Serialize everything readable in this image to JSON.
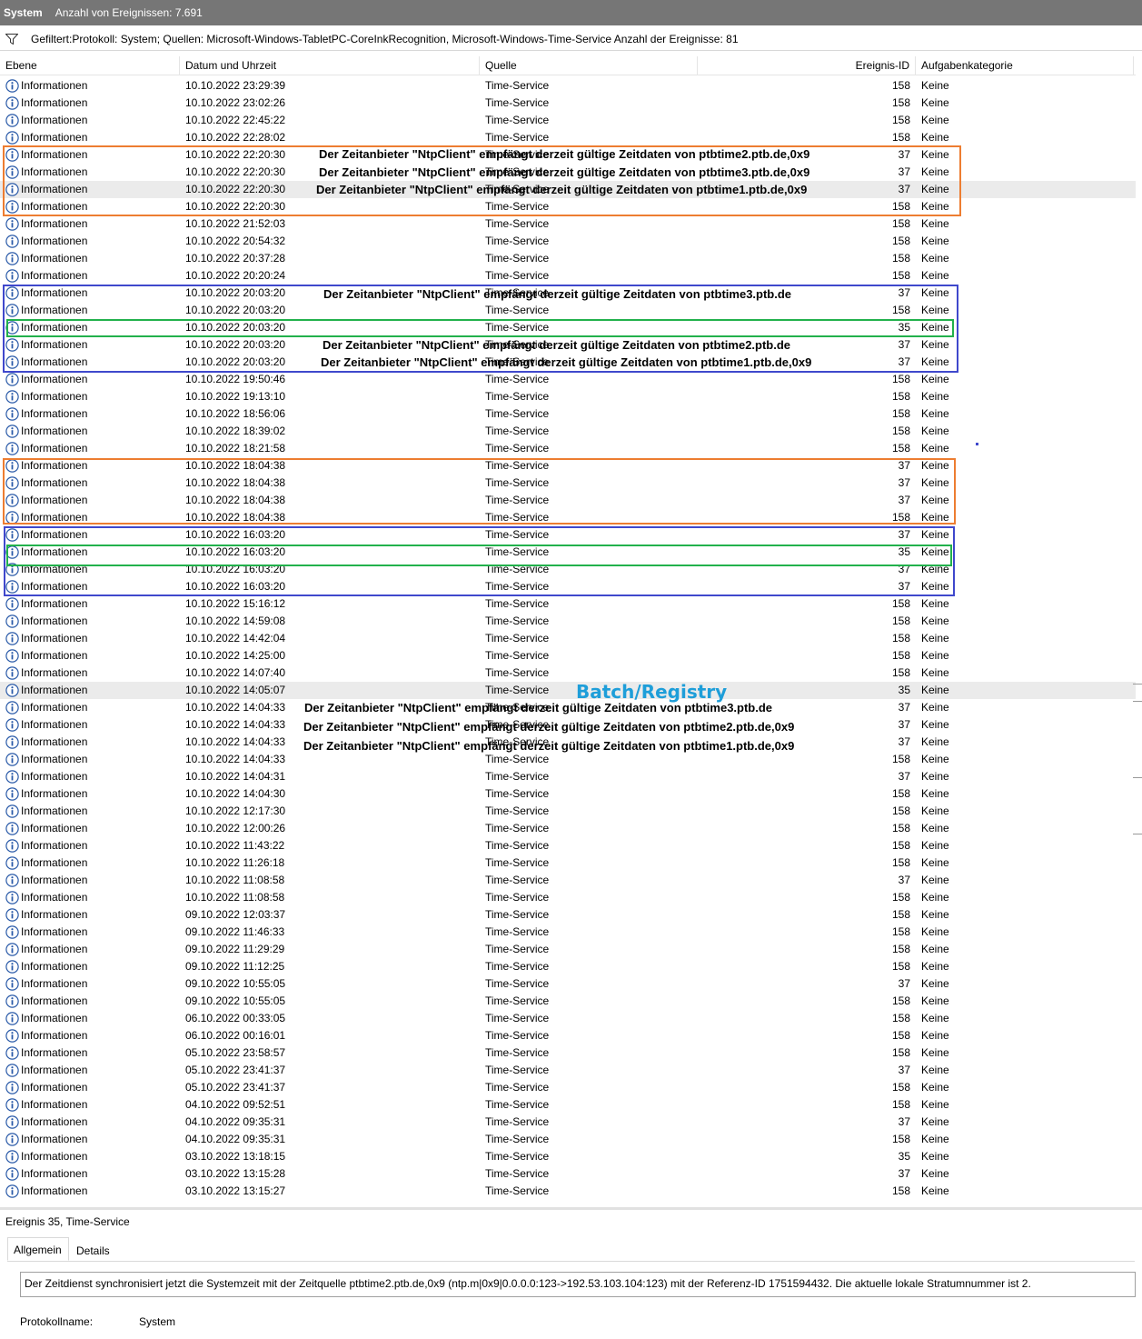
{
  "titlebar": {
    "log_name": "System",
    "event_count": "Anzahl von Ereignissen: 7.691"
  },
  "filter": {
    "text": "Gefiltert:Protokoll: System; Quellen: Microsoft-Windows-TabletPC-CoreInkRecognition, Microsoft-Windows-Time-Service Anzahl der Ereignisse: 81"
  },
  "columns": {
    "level": "Ebene",
    "datetime": "Datum und Uhrzeit",
    "source": "Quelle",
    "event_id": "Ereignis-ID",
    "category": "Aufgabenkategorie"
  },
  "level_text": "Informationen",
  "source_text": "Time-Service",
  "category_text": "Keine",
  "rows": [
    [
      "10.10.2022 23:29:39",
      "158"
    ],
    [
      "10.10.2022 23:02:26",
      "158"
    ],
    [
      "10.10.2022 22:45:22",
      "158"
    ],
    [
      "10.10.2022 22:28:02",
      "158"
    ],
    [
      "10.10.2022 22:20:30",
      "37"
    ],
    [
      "10.10.2022 22:20:30",
      "37"
    ],
    [
      "10.10.2022 22:20:30",
      "37"
    ],
    [
      "10.10.2022 22:20:30",
      "158"
    ],
    [
      "10.10.2022 21:52:03",
      "158"
    ],
    [
      "10.10.2022 20:54:32",
      "158"
    ],
    [
      "10.10.2022 20:37:28",
      "158"
    ],
    [
      "10.10.2022 20:20:24",
      "158"
    ],
    [
      "10.10.2022 20:03:20",
      "37"
    ],
    [
      "10.10.2022 20:03:20",
      "158"
    ],
    [
      "10.10.2022 20:03:20",
      "35"
    ],
    [
      "10.10.2022 20:03:20",
      "37"
    ],
    [
      "10.10.2022 20:03:20",
      "37"
    ],
    [
      "10.10.2022 19:50:46",
      "158"
    ],
    [
      "10.10.2022 19:13:10",
      "158"
    ],
    [
      "10.10.2022 18:56:06",
      "158"
    ],
    [
      "10.10.2022 18:39:02",
      "158"
    ],
    [
      "10.10.2022 18:21:58",
      "158"
    ],
    [
      "10.10.2022 18:04:38",
      "37"
    ],
    [
      "10.10.2022 18:04:38",
      "37"
    ],
    [
      "10.10.2022 18:04:38",
      "37"
    ],
    [
      "10.10.2022 18:04:38",
      "158"
    ],
    [
      "10.10.2022 16:03:20",
      "37"
    ],
    [
      "10.10.2022 16:03:20",
      "35"
    ],
    [
      "10.10.2022 16:03:20",
      "37"
    ],
    [
      "10.10.2022 16:03:20",
      "37"
    ],
    [
      "10.10.2022 15:16:12",
      "158"
    ],
    [
      "10.10.2022 14:59:08",
      "158"
    ],
    [
      "10.10.2022 14:42:04",
      "158"
    ],
    [
      "10.10.2022 14:25:00",
      "158"
    ],
    [
      "10.10.2022 14:07:40",
      "158"
    ],
    [
      "10.10.2022 14:05:07",
      "35"
    ],
    [
      "10.10.2022 14:04:33",
      "37"
    ],
    [
      "10.10.2022 14:04:33",
      "37"
    ],
    [
      "10.10.2022 14:04:33",
      "37"
    ],
    [
      "10.10.2022 14:04:33",
      "158"
    ],
    [
      "10.10.2022 14:04:31",
      "37"
    ],
    [
      "10.10.2022 14:04:30",
      "158"
    ],
    [
      "10.10.2022 12:17:30",
      "158"
    ],
    [
      "10.10.2022 12:00:26",
      "158"
    ],
    [
      "10.10.2022 11:43:22",
      "158"
    ],
    [
      "10.10.2022 11:26:18",
      "158"
    ],
    [
      "10.10.2022 11:08:58",
      "37"
    ],
    [
      "10.10.2022 11:08:58",
      "158"
    ],
    [
      "09.10.2022 12:03:37",
      "158"
    ],
    [
      "09.10.2022 11:46:33",
      "158"
    ],
    [
      "09.10.2022 11:29:29",
      "158"
    ],
    [
      "09.10.2022 11:12:25",
      "158"
    ],
    [
      "09.10.2022 10:55:05",
      "37"
    ],
    [
      "09.10.2022 10:55:05",
      "158"
    ],
    [
      "06.10.2022 00:33:05",
      "158"
    ],
    [
      "06.10.2022 00:16:01",
      "158"
    ],
    [
      "05.10.2022 23:58:57",
      "158"
    ],
    [
      "05.10.2022 23:41:37",
      "37"
    ],
    [
      "05.10.2022 23:41:37",
      "158"
    ],
    [
      "04.10.2022 09:52:51",
      "158"
    ],
    [
      "04.10.2022 09:35:31",
      "37"
    ],
    [
      "04.10.2022 09:35:31",
      "158"
    ],
    [
      "03.10.2022 13:18:15",
      "35"
    ],
    [
      "03.10.2022 13:15:28",
      "37"
    ],
    [
      "03.10.2022 13:15:27",
      "158"
    ]
  ],
  "annotations": {
    "a1": "Der Zeitanbieter \"NtpClient\" empfängt derzeit gültige Zeitdaten von ptbtime2.ptb.de,0x9",
    "a2": "Der Zeitanbieter \"NtpClient\" empfängt derzeit gültige Zeitdaten von ptbtime3.ptb.de,0x9",
    "a3": "Der Zeitanbieter \"NtpClient\" empfängt derzeit gültige Zeitdaten von ptbtime1.ptb.de,0x9",
    "a4": "Der Zeitanbieter \"NtpClient\" empfängt derzeit gültige Zeitdaten von ptbtime3.ptb.de",
    "a5": "Der Zeitanbieter \"NtpClient\" empfängt derzeit gültige Zeitdaten von ptbtime2.ptb.de",
    "a6": "Der Zeitanbieter \"NtpClient\" empfängt derzeit gültige Zeitdaten von ptbtime1.ptb.de,0x9",
    "a7": "Der Zeitanbieter \"NtpClient\" empfängt derzeit gültige Zeitdaten von ptbtime3.ptb.de",
    "a8": "Der Zeitanbieter \"NtpClient\" empfängt derzeit gültige Zeitdaten von ptbtime2.ptb.de,0x9",
    "a9": "Der Zeitanbieter \"NtpClient\" empfängt derzeit gültige Zeitdaten von ptbtime1.ptb.de,0x9",
    "batch": "Batch/Registry"
  },
  "colors": {
    "orange": "#ed7d31",
    "blue": "#3f48cc",
    "green": "#22b14c",
    "batch": "#1e9ed9",
    "titlebar": "#767676"
  },
  "icons": {
    "level": "info-icon",
    "filter": "filter-icon"
  },
  "details": {
    "header": "Ereignis 35, Time-Service",
    "tab_general": "Allgemein",
    "tab_details": "Details",
    "message": "Der Zeitdienst synchronisiert jetzt die Systemzeit mit der Zeitquelle ptbtime2.ptb.de,0x9 (ntp.m|0x9|0.0.0.0:123->192.53.103.104:123) mit der Referenz-ID 1751594432. Die aktuelle lokale Stratumnummer ist 2.",
    "log_label": "Protokollname:",
    "log_value": "System"
  }
}
